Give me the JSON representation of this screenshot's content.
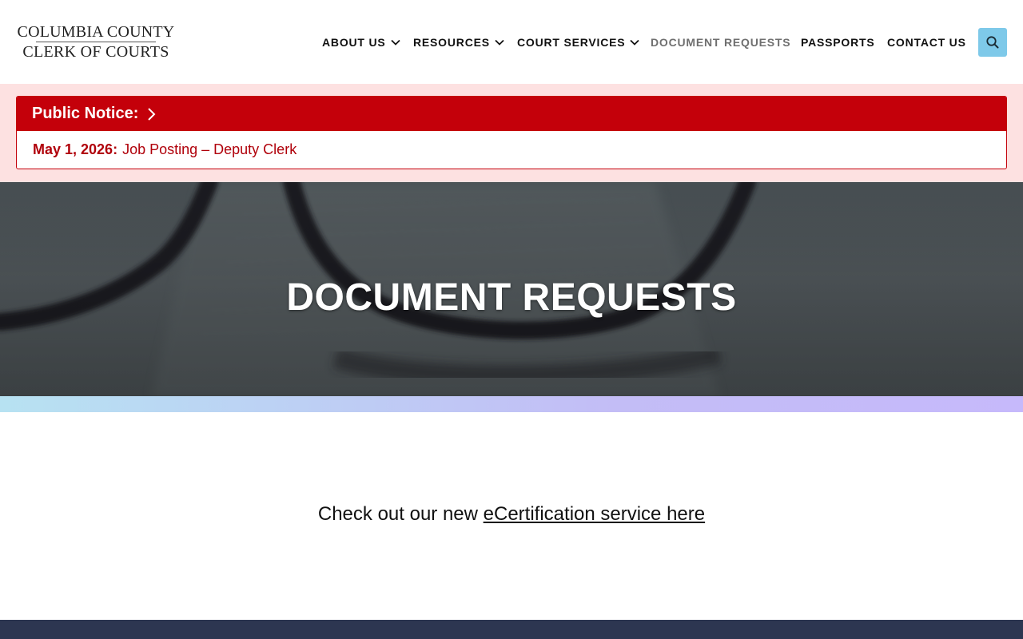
{
  "logo": {
    "line1": "COLUMBIA COUNTY",
    "line2": "CLERK OF COURTS"
  },
  "nav": {
    "items": [
      {
        "label": "ABOUT US",
        "has_dropdown": true
      },
      {
        "label": "RESOURCES",
        "has_dropdown": true
      },
      {
        "label": "COURT SERVICES",
        "has_dropdown": true
      },
      {
        "label": "DOCUMENT REQUESTS",
        "has_dropdown": false,
        "active": true
      },
      {
        "label": "PASSPORTS",
        "has_dropdown": false
      },
      {
        "label": "CONTACT US",
        "has_dropdown": false
      }
    ],
    "search_icon": "search-icon"
  },
  "notice": {
    "heading": "Public Notice:",
    "date": "May 1, 2026:",
    "text": "Job Posting – Deputy Clerk"
  },
  "hero": {
    "title": "DOCUMENT REQUESTS"
  },
  "content": {
    "lead": "Check out our new ",
    "link_text": "eCertification service here"
  },
  "colors": {
    "notice_red": "#c4000a",
    "notice_band": "#fde1e1",
    "search_button": "#7ec9e9",
    "footer": "#2d3651",
    "active_nav": "#6f6f6f"
  }
}
